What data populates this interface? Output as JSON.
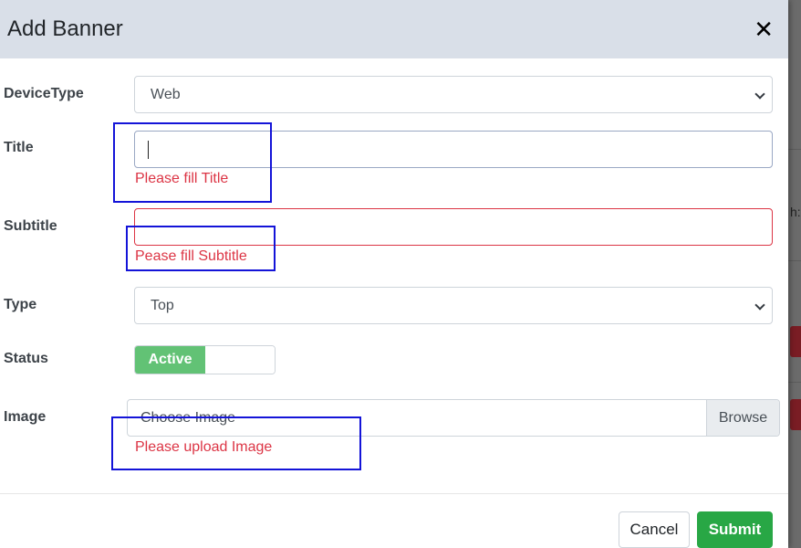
{
  "modal": {
    "title": "Add Banner",
    "close_icon": "close-icon"
  },
  "form": {
    "device_type": {
      "label": "DeviceType",
      "value": "Web"
    },
    "title": {
      "label": "Title",
      "value": "",
      "error": "Please fill Title"
    },
    "subtitle": {
      "label": "Subtitle",
      "value": "",
      "error": "Pease fill Subtitle"
    },
    "type": {
      "label": "Type",
      "value": "Top"
    },
    "status": {
      "label": "Status",
      "value": "Active"
    },
    "image": {
      "label": "Image",
      "placeholder": "Choose Image",
      "browse_label": "Browse",
      "error": "Please upload Image"
    }
  },
  "footer": {
    "cancel_label": "Cancel",
    "submit_label": "Submit"
  },
  "background": {
    "partial_text": "h:"
  },
  "colors": {
    "error": "#dc3545",
    "success": "#28a745",
    "toggle_active": "#62c275",
    "annotation": "#1414d8",
    "header_bg": "#d9dfe8"
  }
}
